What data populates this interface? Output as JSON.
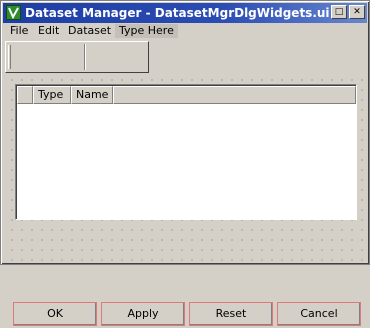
{
  "window": {
    "title": "Dataset Manager - DatasetMgrDlgWidgets.ui",
    "maximize_glyph": "□",
    "close_glyph": "✕"
  },
  "menubar": {
    "items": [
      {
        "label": "File"
      },
      {
        "label": "Edit"
      },
      {
        "label": "Dataset"
      },
      {
        "label": "Type Here"
      }
    ]
  },
  "table": {
    "columns": [
      {
        "label": "Type"
      },
      {
        "label": "Name"
      }
    ],
    "rows": []
  },
  "buttons": {
    "ok": "OK",
    "apply": "Apply",
    "reset": "Reset",
    "cancel": "Cancel"
  }
}
